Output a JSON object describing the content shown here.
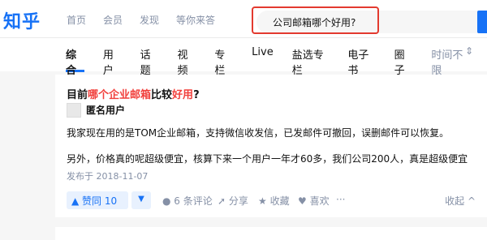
{
  "header": {
    "logo": "知乎",
    "nav": [
      "首页",
      "会员",
      "发现",
      "等你来答"
    ],
    "search_value": "公司邮箱哪个好用?"
  },
  "tabs": [
    "综合",
    "用户",
    "话题",
    "视频",
    "专栏",
    "Live",
    "盐选专栏",
    "电子书",
    "圈子",
    "时间不限"
  ],
  "sort_icon": "⇕",
  "result": {
    "title_pre": "目前",
    "title_hl1": "哪个企业邮箱",
    "title_mid": "比较",
    "title_hl2": "好用",
    "title_post": "?",
    "author": "匿名用户",
    "para1": "我家现在用的是TOM企业邮箱，支持微信收发信，已发邮件可撤回，误删邮件可以恢复。",
    "para2": "另外，价格真的呢超级便宜，核算下来一个用户一年才60多，我们公司200人，真是超级便宜",
    "date": "发布于 2018-11-07",
    "vote_up": "▲ 赞同 10",
    "vote_down": "▼",
    "comments": "● 6 条评论",
    "share": "➚ 分享",
    "favorite": "★ 收藏",
    "like": "♥ 喜欢",
    "more": "···",
    "collapse": "收起 ^"
  }
}
